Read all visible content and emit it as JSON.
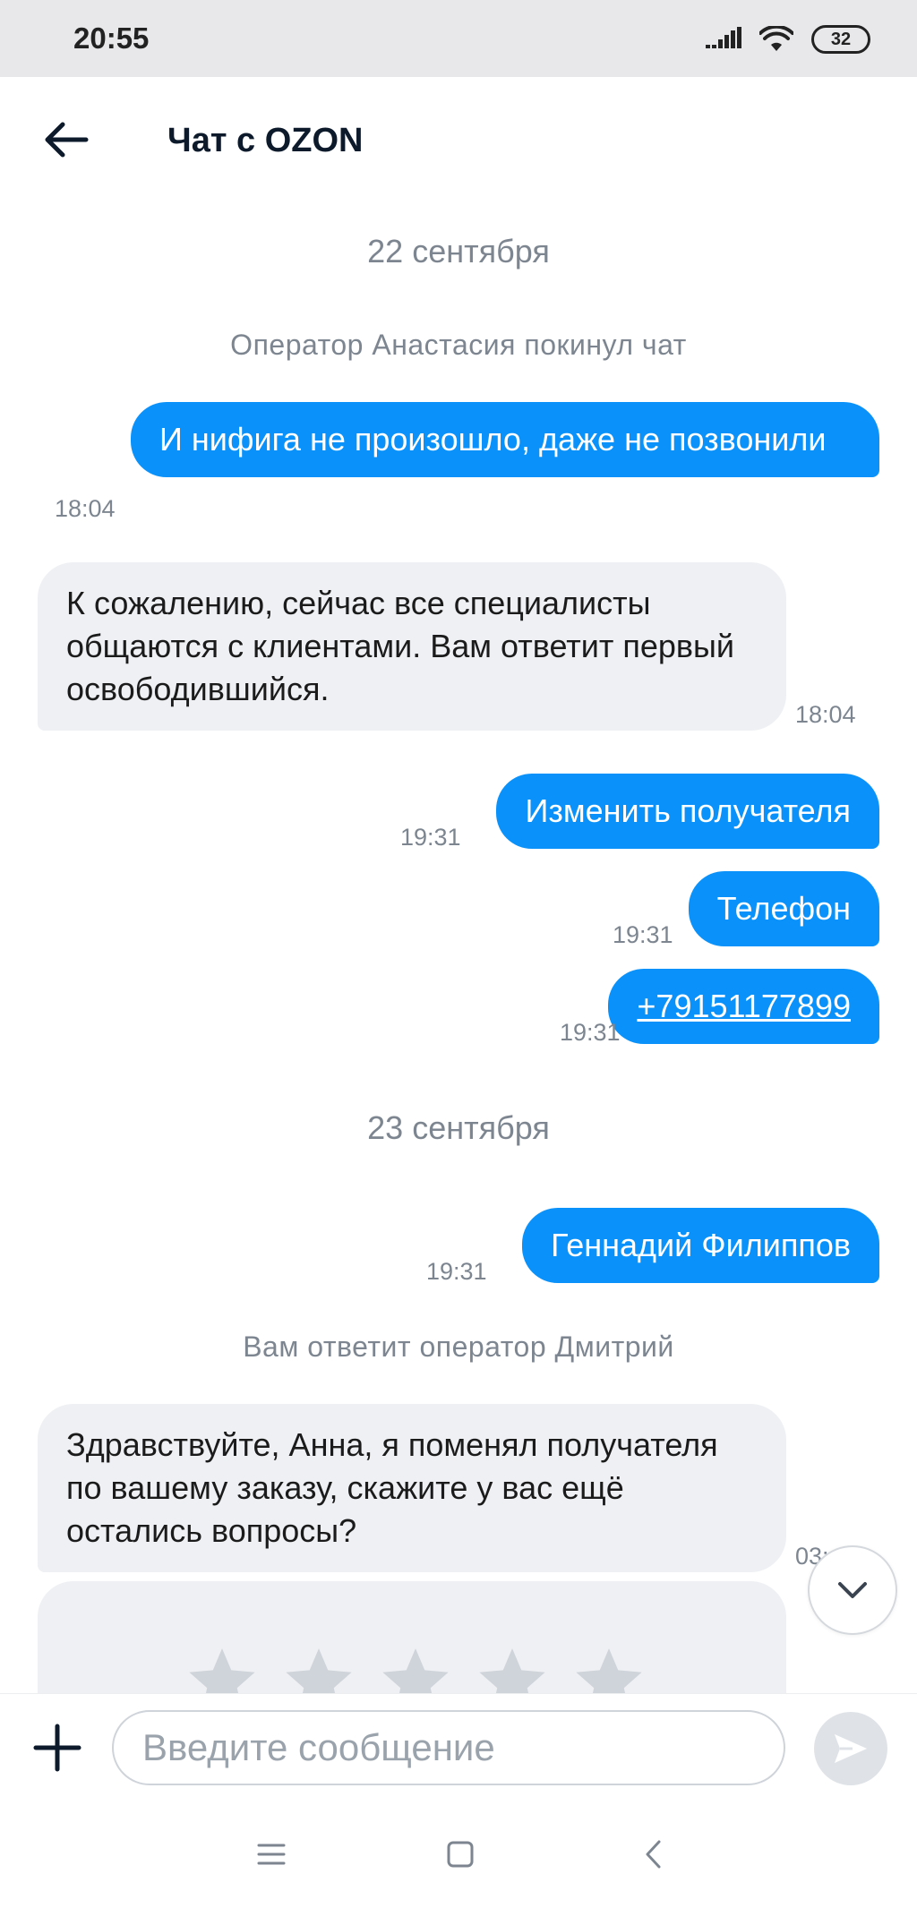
{
  "status_bar": {
    "time": "20:55",
    "battery": "32",
    "icons": [
      "signal-icon",
      "wifi-icon",
      "battery-icon"
    ]
  },
  "header": {
    "title": "Чат с OZON",
    "back_icon": "arrow-left-icon"
  },
  "chat": {
    "date_1": "22 сентября",
    "system_1": "Оператор Анастасия покинул чат",
    "messages": [
      {
        "from": "user",
        "text": "И нифига не произошло, даже не позвонили",
        "time": "18:04"
      },
      {
        "from": "operator",
        "text": "К сожалению, сейчас все специалисты общаются с клиентами. Вам ответит первый освободившийся.",
        "time": "18:04"
      },
      {
        "from": "user",
        "text": "Изменить получателя",
        "time": "19:31"
      },
      {
        "from": "user",
        "text": "Телефон",
        "time": "19:31"
      },
      {
        "from": "user",
        "text": "+79151177899",
        "time": "19:31"
      },
      {
        "from": "user",
        "text": "Геннадий Филиппов",
        "time": "19:31"
      },
      {
        "from": "operator",
        "text": "Здравствуйте, Анна, я поменял получателя по вашему заказу, скажите у вас ещё остались вопросы?",
        "time": "03:"
      }
    ],
    "date_2": "23 сентября",
    "system_2": "Вам ответит оператор Дмитрий",
    "rating": {
      "max_stars": 5,
      "selected": 0
    }
  },
  "composer": {
    "placeholder": "Введите сообщение",
    "value": ""
  },
  "colors": {
    "outgoing_bubble": "#0a92fa",
    "incoming_bubble": "#eef0f3",
    "muted_text": "#7d8690"
  }
}
